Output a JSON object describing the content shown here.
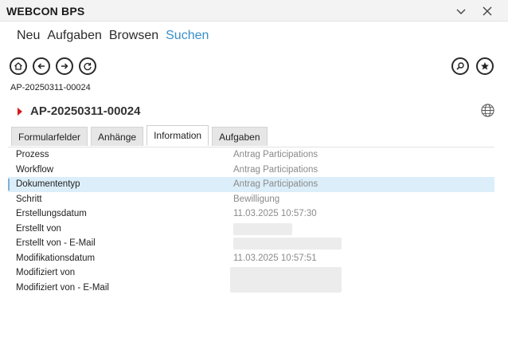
{
  "window": {
    "title": "WEBCON BPS"
  },
  "menu": {
    "items": [
      {
        "label": "Neu",
        "active": false
      },
      {
        "label": "Aufgaben",
        "active": false
      },
      {
        "label": "Browsen",
        "active": false
      },
      {
        "label": "Suchen",
        "active": true
      }
    ]
  },
  "nav": {
    "icons": [
      "home-icon",
      "back-icon",
      "forward-icon",
      "refresh-icon"
    ],
    "right_icons": [
      "search-icon",
      "star-icon"
    ]
  },
  "breadcrumb": "AP-20250311-00024",
  "document": {
    "title": "AP-20250311-00024"
  },
  "tabs": [
    {
      "label": "Formularfelder",
      "active": false
    },
    {
      "label": "Anhänge",
      "active": false
    },
    {
      "label": "Information",
      "active": true
    },
    {
      "label": "Aufgaben",
      "active": false
    }
  ],
  "info_rows": [
    {
      "label": "Prozess",
      "value": "Antrag Participations"
    },
    {
      "label": "Workflow",
      "value": "Antrag Participations"
    },
    {
      "label": "Dokumententyp",
      "value": "Antrag Participations",
      "selected": true
    },
    {
      "label": "Schritt",
      "value": "Bewilligung"
    },
    {
      "label": "Erstellungsdatum",
      "value": "11.03.2025 10:57:30"
    },
    {
      "label": "Erstellt von",
      "value": ""
    },
    {
      "label": "Erstellt von - E-Mail",
      "value": ""
    },
    {
      "label": "Modifikationsdatum",
      "value": "11.03.2025 10:57:51"
    },
    {
      "label": "Modifiziert von",
      "value": ""
    },
    {
      "label": "Modifiziert von - E-Mail",
      "value": ""
    }
  ],
  "colors": {
    "accent": "#3a8fc8",
    "selected_row": "#dbeefa",
    "doc_marker": "#d21c1c"
  }
}
